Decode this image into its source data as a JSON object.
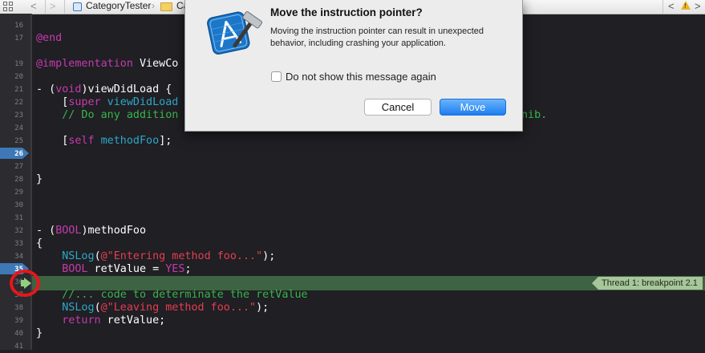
{
  "jumpbar": {
    "project": "CategoryTester",
    "group": "Ca",
    "back": "<",
    "forward": ">",
    "chevron": "›",
    "left_nav": "<",
    "right_nav": ">",
    "warning_mark": "!",
    "icons": [
      "related-items-icon",
      "back-icon",
      "forward-icon",
      "project-icon",
      "folder-icon",
      "warning-icon"
    ]
  },
  "line_numbers": [
    "16",
    "17",
    "19",
    "20",
    "21",
    "22",
    "23",
    "24",
    "25",
    "26",
    "27",
    "28",
    "29",
    "30",
    "31",
    "32",
    "33",
    "34",
    "35",
    "36",
    "37",
    "38",
    "39",
    "40",
    "41"
  ],
  "breakpoint_lines": [
    "26",
    "35"
  ],
  "current_line": "36",
  "editor": {
    "l16": "",
    "l17": "@end",
    "l19_kw": "@implementation",
    "l19_rest": " ViewCo",
    "l21_a": "- (",
    "l21_kw": "void",
    "l21_b": ")viewDidLoad {",
    "l22_a": "    [",
    "l22_kw": "super",
    "l22_n": " viewDidLoad",
    "l23_c": "    // Do any addition",
    "l23_tail": "nib.",
    "l24_a": "    [",
    "l24_kw": "self",
    "l24_n": " methodFoo",
    "l24_b": "];",
    "l27": "}",
    "l31_a": "- (",
    "l31_kw": "BOOL",
    "l31_b": ")methodFoo",
    "l32": "{",
    "l33_n": "    NSLog",
    "l33_a": "(",
    "l33_s": "@\"Entering method foo...\"",
    "l33_b": ");",
    "l34_kw": "    BOOL",
    "l34_a": " retValue = ",
    "l34_kw2": "YES",
    "l34_b": ";",
    "l37_c": "    //... code to determinate the retValue",
    "l38_n": "    NSLog",
    "l38_a": "(",
    "l38_s": "@\"Leaving method foo...\"",
    "l38_b": ");",
    "l39_kw": "    return",
    "l39_a": " retValue;",
    "l40": "}"
  },
  "thread_badge": "Thread 1: breakpoint 2.1",
  "dialog": {
    "title": "Move the instruction pointer?",
    "message": "Moving the instruction pointer can result in unexpected behavior, including crashing your application.",
    "checkbox_label": "Do not show this message again",
    "checkbox_checked": false,
    "cancel_label": "Cancel",
    "move_label": "Move",
    "icon": "xcode-hammer-icon"
  },
  "colors": {
    "editor_bg": "#1f1f24",
    "keyword": "#c53bab",
    "comment": "#39b54a",
    "string": "#e63e4c",
    "identifier": "#2ea7c5",
    "breakpoint": "#3e78b6",
    "current_line": "#3e6342",
    "annotation_circle": "#e8161a",
    "primary_button": "#1b7ef0"
  }
}
